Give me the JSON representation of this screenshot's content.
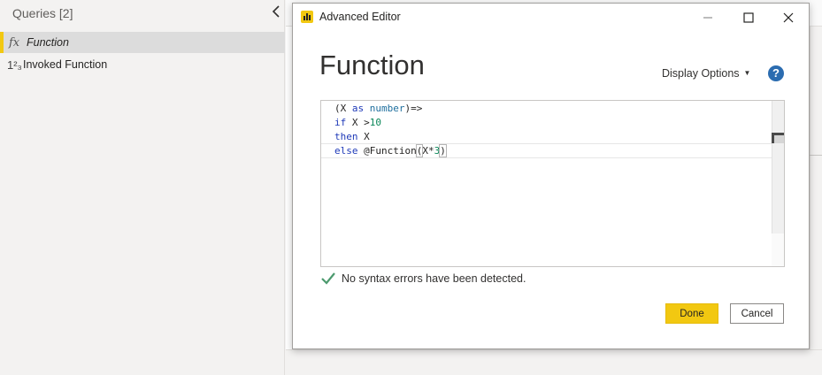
{
  "queries_pane": {
    "header": "Queries [2]",
    "items": [
      {
        "icon": "fx-icon",
        "icon_text": "fx",
        "label": "Function",
        "selected": true
      },
      {
        "icon": "number-type-icon",
        "icon_text": "1²₃",
        "label": "Invoked Function",
        "selected": false
      }
    ]
  },
  "dialog": {
    "title": "Advanced Editor",
    "heading": "Function",
    "display_options": "Display Options",
    "help": "?",
    "code": {
      "line1": {
        "paren": "(X ",
        "kw": "as",
        "sp": " ",
        "type": "number",
        "tail": ")=>"
      },
      "line2": {
        "kw": "if",
        "mid": " X >",
        "num": "10"
      },
      "line3": {
        "kw": "then",
        "tail": " X"
      },
      "line4": {
        "kw": "else",
        "mid": " @Function",
        "open": "(",
        "arg": "X*",
        "num": "3",
        "close": ")"
      }
    },
    "status": "No syntax errors have been detected.",
    "done_label": "Done",
    "cancel_label": "Cancel"
  },
  "colors": {
    "accent": "#f2c811",
    "keyword": "#1f3ab8",
    "number": "#098658",
    "success": "#4c9a6e",
    "help": "#2b6cb0"
  }
}
